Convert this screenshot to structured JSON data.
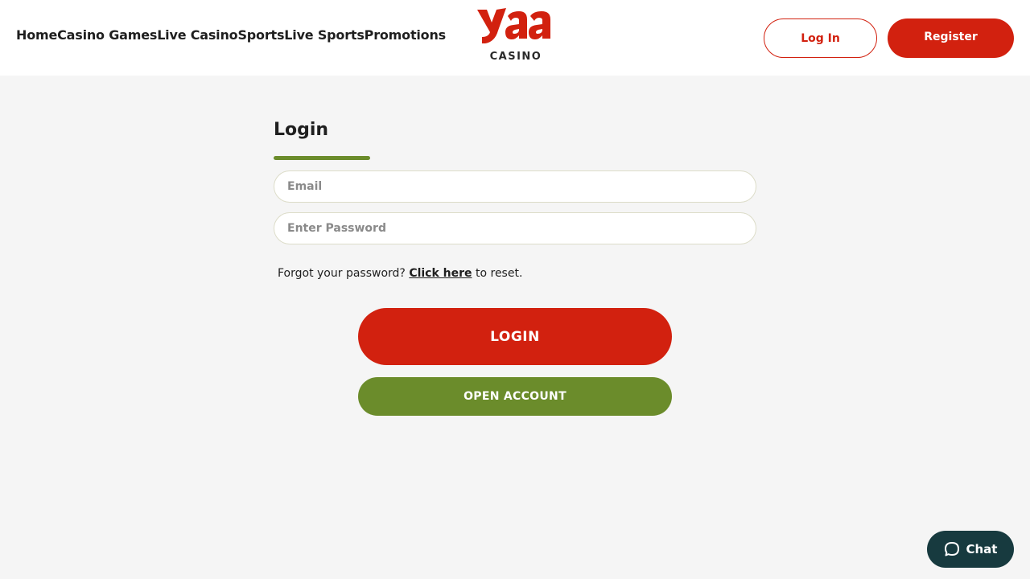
{
  "header": {
    "nav": [
      {
        "label": "Home"
      },
      {
        "label": "Casino Games"
      },
      {
        "label": "Live Casino"
      },
      {
        "label": "Sports"
      },
      {
        "label": "Live Sports"
      },
      {
        "label": "Promotions"
      }
    ],
    "logo": {
      "wordmark": "yaa",
      "subtitle": "CASINO"
    },
    "login_label": "Log In",
    "register_label": "Register"
  },
  "login_form": {
    "title": "Login",
    "email_placeholder": "Email",
    "email_value": "",
    "password_placeholder": "Enter Password",
    "password_value": "",
    "forgot_prefix": "Forgot your password?",
    "forgot_link": "Click here",
    "forgot_suffix": "to reset.",
    "submit_label": "LOGIN",
    "open_account_label": "OPEN ACCOUNT"
  },
  "chat": {
    "label": "Chat",
    "icon": "chat-bubble-icon"
  },
  "colors": {
    "brand_red": "#d2210f",
    "brand_green": "#6b8c2b",
    "chat_bg": "#173a3f",
    "page_bg": "#f5f5f5"
  }
}
